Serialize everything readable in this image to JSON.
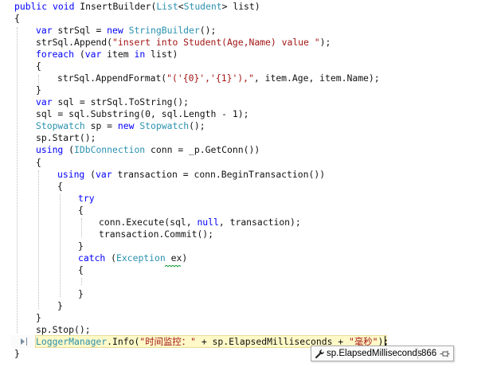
{
  "code_lines": [
    [
      {
        "t": "public void",
        "c": "kw"
      },
      {
        "t": " InsertBuilder(",
        "c": "plain"
      },
      {
        "t": "List",
        "c": "type"
      },
      {
        "t": "<",
        "c": "plain"
      },
      {
        "t": "Student",
        "c": "type"
      },
      {
        "t": "> list)",
        "c": "plain"
      }
    ],
    [
      {
        "t": "{",
        "c": "plain"
      }
    ],
    [
      {
        "t": "var",
        "c": "kw"
      },
      {
        "t": " strSql = ",
        "c": "plain"
      },
      {
        "t": "new",
        "c": "kw"
      },
      {
        "t": " ",
        "c": "plain"
      },
      {
        "t": "StringBuilder",
        "c": "type"
      },
      {
        "t": "();",
        "c": "plain"
      }
    ],
    [
      {
        "t": "strSql.Append(",
        "c": "plain"
      },
      {
        "t": "\"insert into Student(Age,Name) value \"",
        "c": "str"
      },
      {
        "t": ");",
        "c": "plain"
      }
    ],
    [
      {
        "t": "foreach",
        "c": "kw"
      },
      {
        "t": " (",
        "c": "plain"
      },
      {
        "t": "var",
        "c": "kw"
      },
      {
        "t": " item ",
        "c": "plain"
      },
      {
        "t": "in",
        "c": "kw"
      },
      {
        "t": " list)",
        "c": "plain"
      }
    ],
    [
      {
        "t": "{",
        "c": "plain"
      }
    ],
    [
      {
        "t": "strSql.AppendFormat(",
        "c": "plain"
      },
      {
        "t": "\"('{0}','{1}'),\"",
        "c": "str"
      },
      {
        "t": ", item.Age, item.Name);",
        "c": "plain"
      }
    ],
    [
      {
        "t": "}",
        "c": "plain"
      }
    ],
    [
      {
        "t": "var",
        "c": "kw"
      },
      {
        "t": " sql = strSql.ToString();",
        "c": "plain"
      }
    ],
    [
      {
        "t": "sql = sql.Substring(0, sql.Length - 1);",
        "c": "plain"
      }
    ],
    [
      {
        "t": "Stopwatch",
        "c": "type"
      },
      {
        "t": " sp = ",
        "c": "plain"
      },
      {
        "t": "new",
        "c": "kw"
      },
      {
        "t": " ",
        "c": "plain"
      },
      {
        "t": "Stopwatch",
        "c": "type"
      },
      {
        "t": "();",
        "c": "plain"
      }
    ],
    [
      {
        "t": "sp.Start();",
        "c": "plain"
      }
    ],
    [
      {
        "t": "using",
        "c": "kw"
      },
      {
        "t": " (",
        "c": "plain"
      },
      {
        "t": "IDbConnection",
        "c": "type"
      },
      {
        "t": " conn = _p.GetConn())",
        "c": "plain"
      }
    ],
    [
      {
        "t": "{",
        "c": "plain"
      }
    ],
    [
      {
        "t": "using",
        "c": "kw"
      },
      {
        "t": " (",
        "c": "plain"
      },
      {
        "t": "var",
        "c": "kw"
      },
      {
        "t": " transaction = conn.BeginTransaction())",
        "c": "plain"
      }
    ],
    [
      {
        "t": "{",
        "c": "plain"
      }
    ],
    [
      {
        "t": "try",
        "c": "kw"
      }
    ],
    [
      {
        "t": "{",
        "c": "plain"
      }
    ],
    [
      {
        "t": "conn.Execute(sql, ",
        "c": "plain"
      },
      {
        "t": "null",
        "c": "kw"
      },
      {
        "t": ", transaction);",
        "c": "plain"
      }
    ],
    [
      {
        "t": "transaction.Commit();",
        "c": "plain"
      }
    ],
    [
      {
        "t": "}",
        "c": "plain"
      }
    ],
    [
      {
        "t": "catch",
        "c": "kw"
      },
      {
        "t": " (",
        "c": "plain"
      },
      {
        "t": "Exception",
        "c": "type"
      },
      {
        "t": " ex)",
        "c": "plain"
      }
    ],
    [
      {
        "t": "{",
        "c": "plain"
      }
    ],
    [],
    [
      {
        "t": "}",
        "c": "plain"
      }
    ],
    [
      {
        "t": "}",
        "c": "plain"
      }
    ],
    [
      {
        "t": "}",
        "c": "plain"
      }
    ],
    [
      {
        "t": "sp.Stop();",
        "c": "plain"
      }
    ],
    [
      {
        "t": "LoggerManager",
        "c": "type"
      },
      {
        "t": ".Info(",
        "c": "plain"
      },
      {
        "t": "\"时间监控：\"",
        "c": "str"
      },
      {
        "t": " + sp.ElapsedMilliseconds + ",
        "c": "plain"
      },
      {
        "t": "\"毫秒\"",
        "c": "str"
      },
      {
        "t": ");",
        "c": "plain"
      }
    ],
    [
      {
        "t": "}",
        "c": "plain"
      }
    ]
  ],
  "datatip": {
    "icon": "wrench-icon",
    "expression": "sp.ElapsedMilliseconds",
    "value": "866",
    "pin_icon": "pin-icon"
  },
  "colors": {
    "keyword": "#0000ff",
    "type": "#2b91af",
    "string": "#a31515",
    "current_statement": "#fff9c8"
  }
}
